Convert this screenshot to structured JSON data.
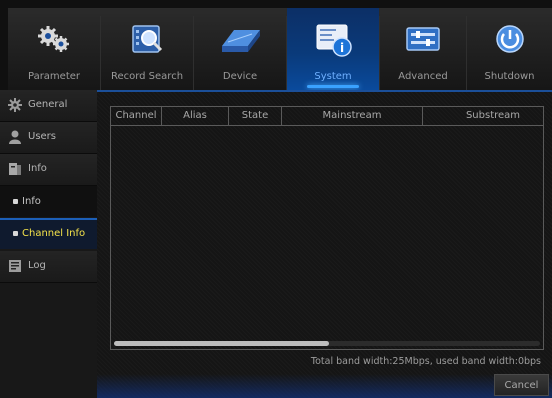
{
  "menu": {
    "items": [
      {
        "label": "Parameter",
        "icon": "gears-icon"
      },
      {
        "label": "Record Search",
        "icon": "record-search-icon"
      },
      {
        "label": "Device",
        "icon": "hard-drive-icon"
      },
      {
        "label": "System",
        "icon": "system-info-icon"
      },
      {
        "label": "Advanced",
        "icon": "advanced-settings-icon"
      },
      {
        "label": "Shutdown",
        "icon": "power-icon"
      }
    ],
    "active": "System"
  },
  "sidebar": {
    "items": [
      {
        "label": "General",
        "icon": "gear-icon"
      },
      {
        "label": "Users",
        "icon": "user-icon"
      },
      {
        "label": "Info",
        "icon": "info-book-icon"
      }
    ],
    "sub_items": [
      {
        "label": "Info"
      },
      {
        "label": "Channel Info"
      }
    ],
    "after": [
      {
        "label": "Log",
        "icon": "log-icon"
      }
    ],
    "active": "Channel Info"
  },
  "table": {
    "columns": [
      "Channel",
      "Alias",
      "State",
      "Mainstream",
      "Substream"
    ],
    "rows": []
  },
  "footer": {
    "bandwidth_text": "Total band width:25Mbps, used band width:0bps"
  },
  "buttons": {
    "cancel_label": "Cancel"
  },
  "colors": {
    "active_menu": "#0a3a7a",
    "active_sub_text": "#f4e24a",
    "accent_line": "#1c5fb8"
  }
}
